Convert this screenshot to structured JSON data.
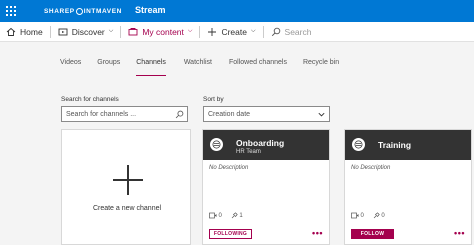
{
  "brand": {
    "logo_left": "SHAREP",
    "logo_right": "INTMAVEN",
    "app_title": "Stream",
    "accent": "#0078d4",
    "highlight": "#a4004e"
  },
  "commandbar": {
    "home": "Home",
    "discover": "Discover",
    "my_content": "My content",
    "create": "Create",
    "search_placeholder": "Search"
  },
  "tabs": [
    "Videos",
    "Groups",
    "Channels",
    "Watchlist",
    "Followed channels",
    "Recycle bin"
  ],
  "active_tab": "Channels",
  "search": {
    "label": "Search for channels",
    "placeholder": "Search for channels ..."
  },
  "sort": {
    "label": "Sort by",
    "value": "Creation date"
  },
  "create_card": {
    "label": "Create a new channel"
  },
  "channels": [
    {
      "name": "Onboarding",
      "owner": "HR Team",
      "description": "No Description",
      "videos": "0",
      "followers": "1",
      "button": "FOLLOWING"
    },
    {
      "name": "Training",
      "owner": "",
      "description": "No Description",
      "videos": "0",
      "followers": "0",
      "button": "FOLLOW"
    }
  ],
  "more_label": "•••"
}
